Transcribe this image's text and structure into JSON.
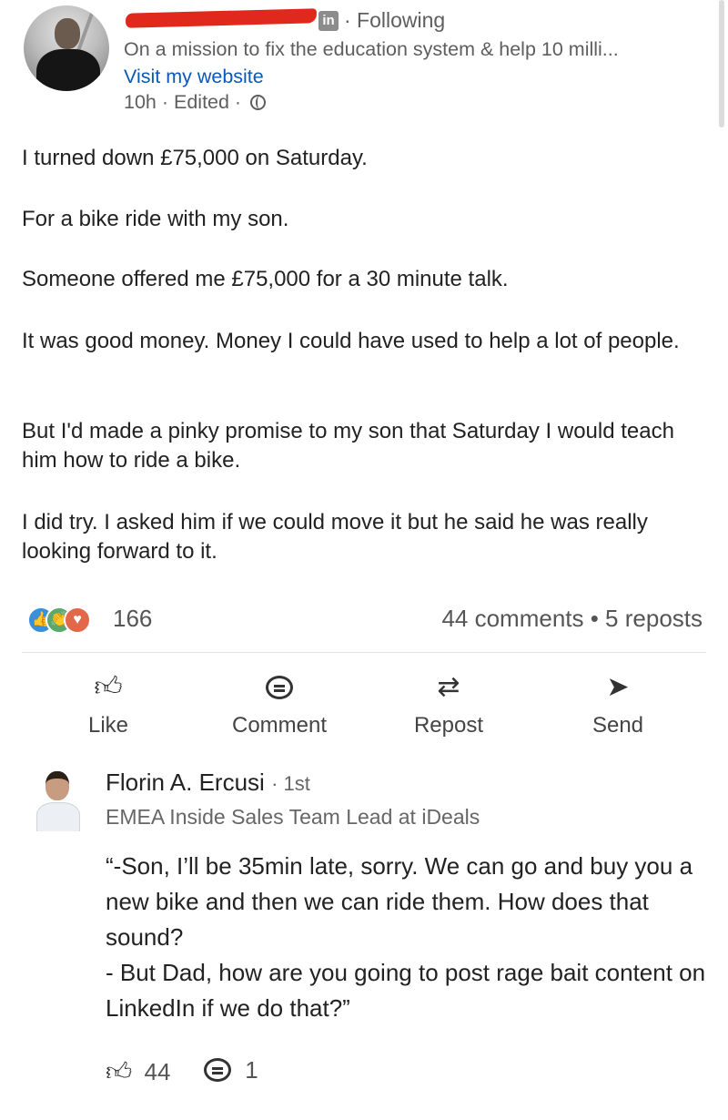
{
  "post": {
    "author": {
      "connection": "· Following",
      "headline": "On a mission to fix the education system & help 10 milli...",
      "website_link": "Visit my website",
      "timestamp": "10h",
      "edited": "· Edited ·",
      "linkedin_badge": "in"
    },
    "paragraphs": [
      "I turned down £75,000 on Saturday.",
      "For a bike ride with my son.",
      "Someone offered me £75,000 for a 30 minute talk.",
      "It was good money. Money I could have used to help a lot of people.",
      "But I'd made a pinky promise to my son that Saturday I would teach him how to ride a bike.",
      "I did try. I asked him if we could move it but he said he was really looking forward to it."
    ],
    "reaction_count": "166",
    "comments_reposts": "44 comments • 5 reposts",
    "reaction_icons": [
      "like-icon",
      "celebrate-icon",
      "love-icon"
    ]
  },
  "actions": {
    "like": "Like",
    "comment": "Comment",
    "repost": "Repost",
    "send": "Send"
  },
  "comment": {
    "name": "Florin A. Ercusi",
    "degree": "· 1st",
    "title": "EMEA Inside Sales Team Lead at iDeals",
    "text": "“-Son, I’ll be 35min late, sorry. We can go and buy you a new bike and then we can ride them. How does that sound?\n- But Dad, how are you going to post rage bait content on LinkedIn if we do that?”",
    "likes": "44",
    "replies": "1"
  },
  "colors": {
    "link": "#0a58b8",
    "redaction": "#e0291c",
    "secondary_text": "#5e5e5e"
  }
}
